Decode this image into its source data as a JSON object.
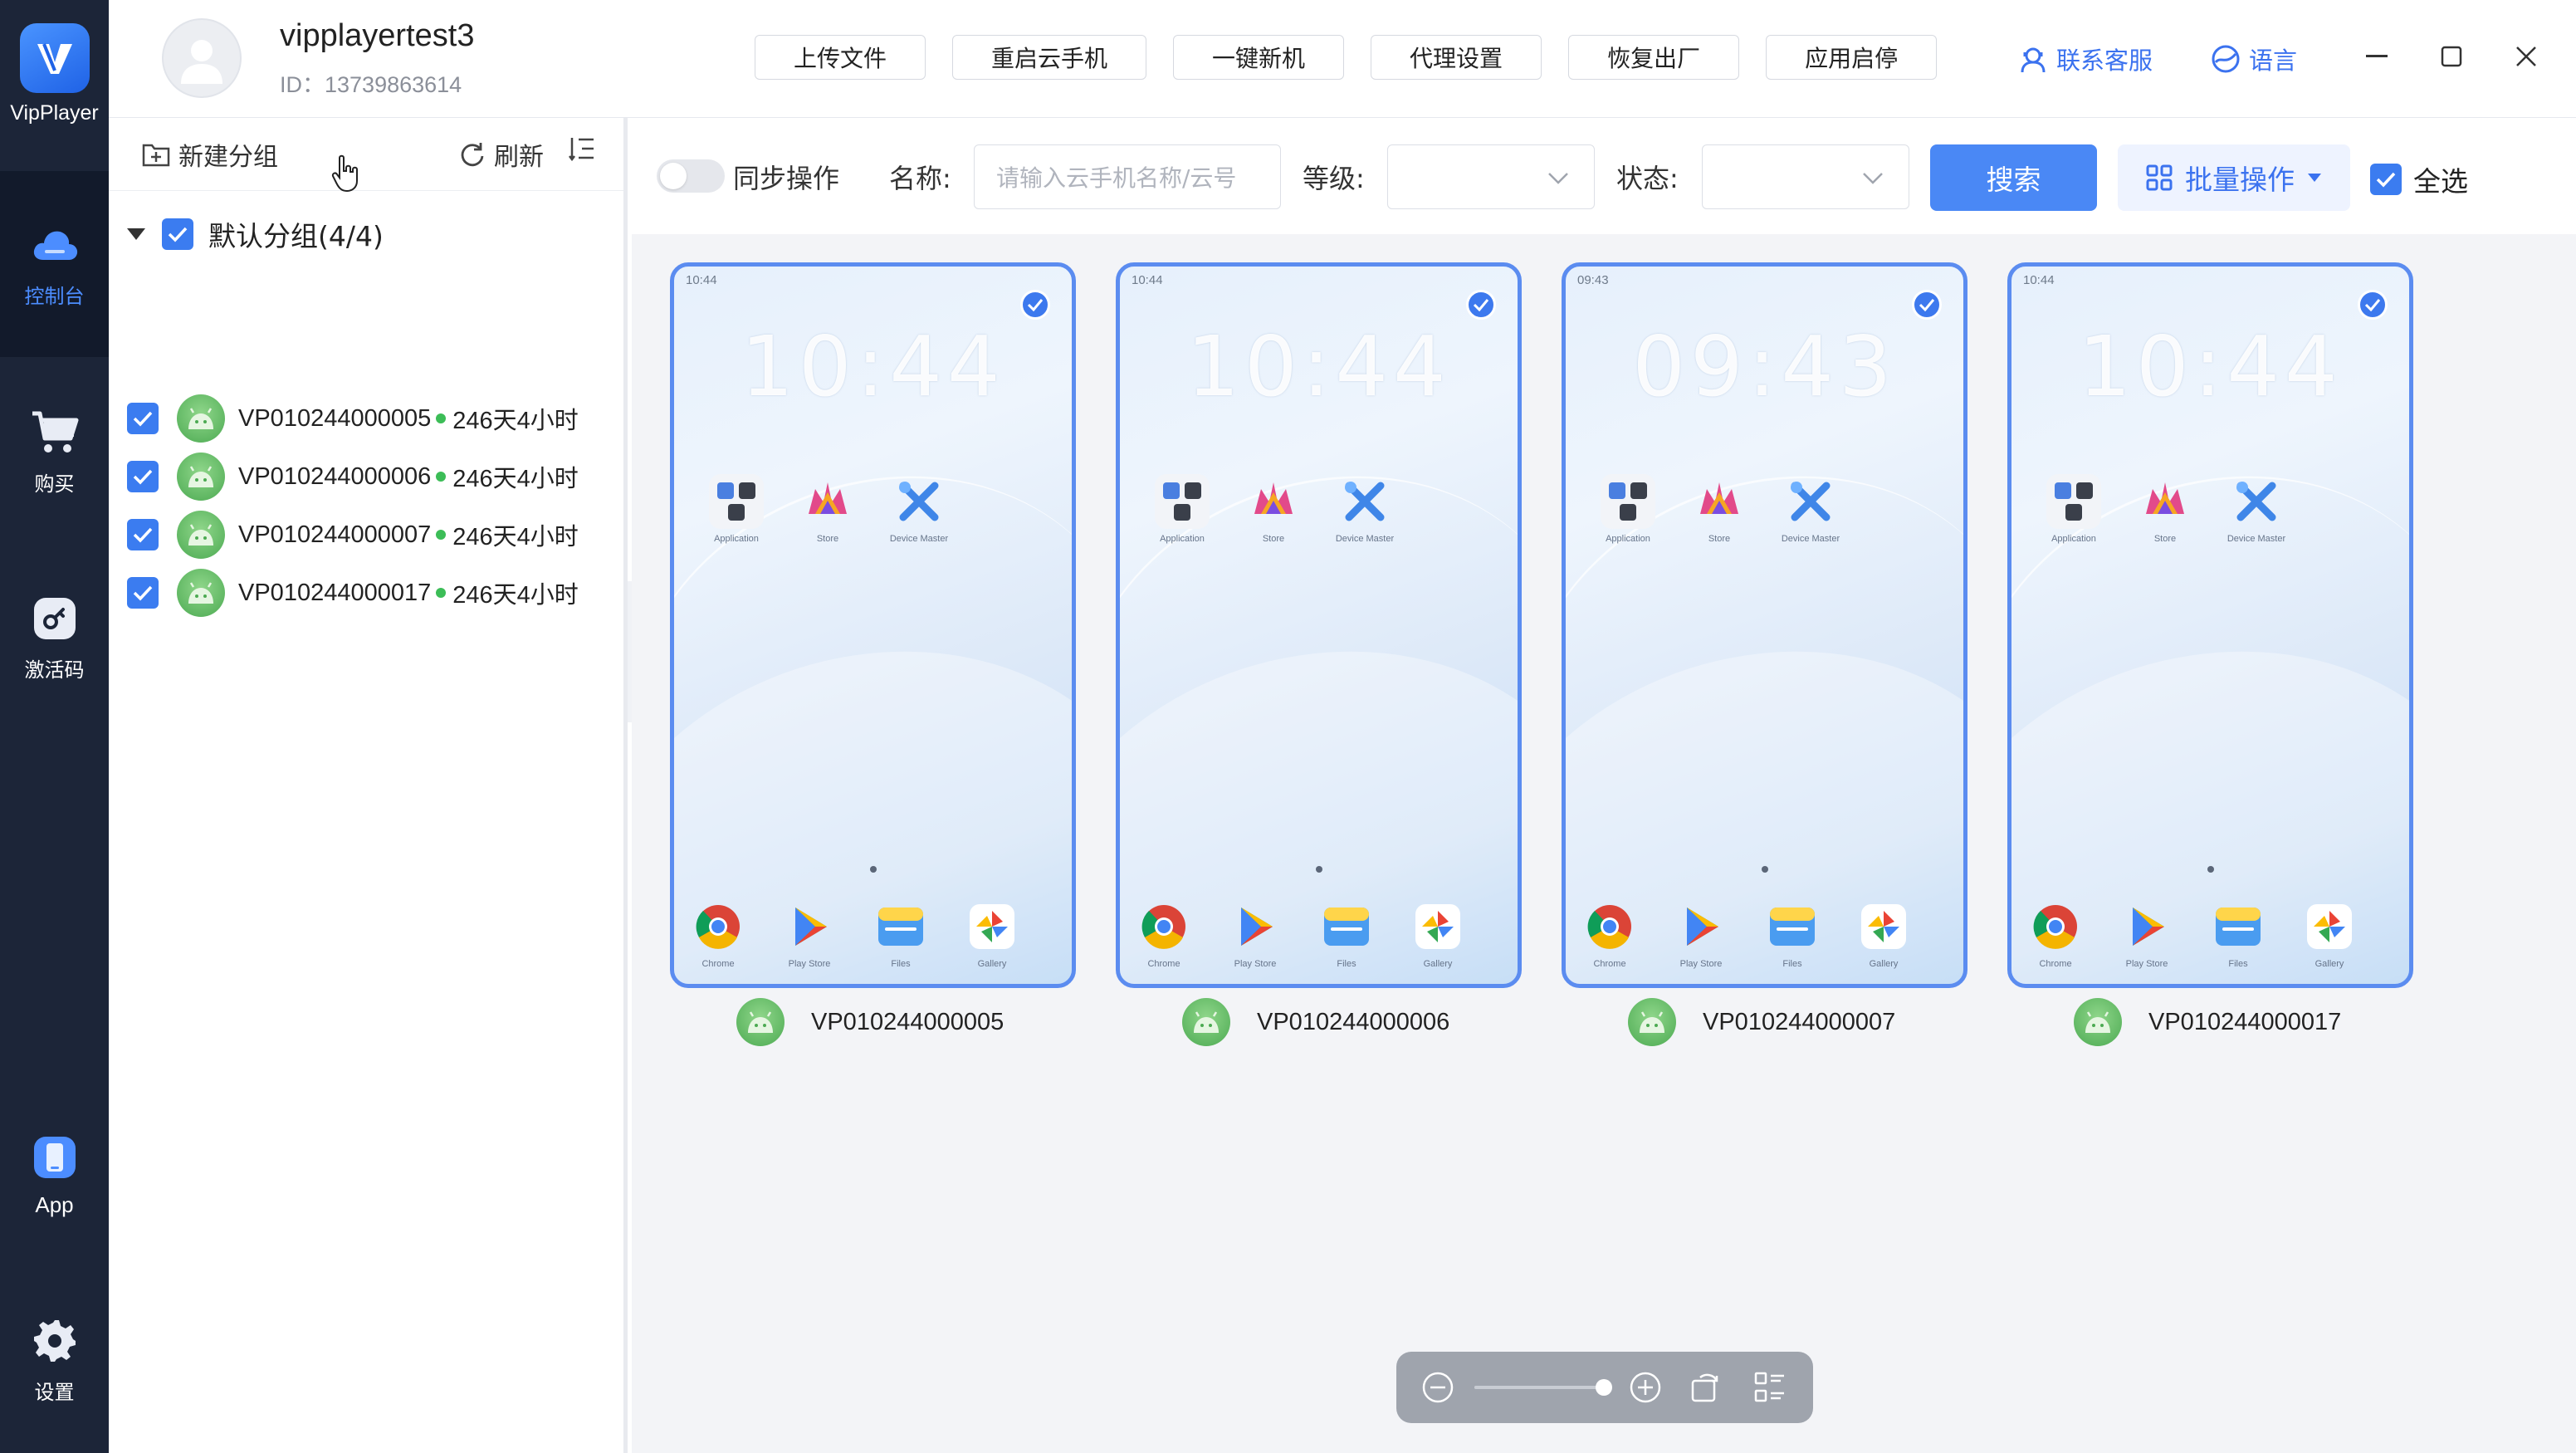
{
  "app": {
    "name": "VipPlayer"
  },
  "nav": [
    {
      "label": "控制台",
      "icon": "cloud-icon",
      "active": true
    },
    {
      "label": "购买",
      "icon": "cart-icon",
      "active": false
    },
    {
      "label": "激活码",
      "icon": "key-icon",
      "active": false
    },
    {
      "label": "App",
      "icon": "phone-icon",
      "active": false
    },
    {
      "label": "设置",
      "icon": "gear-icon",
      "active": false
    }
  ],
  "user": {
    "name": "vipplayertest3",
    "id": "ID：13739863614"
  },
  "top_actions": [
    "上传文件",
    "重启云手机",
    "一键新机",
    "代理设置",
    "恢复出厂",
    "应用启停"
  ],
  "top_links": {
    "support": "联系客服",
    "language": "语言"
  },
  "panel": {
    "new_group": "新建分组",
    "refresh": "刷新",
    "group_label": "默认分组(4/4)",
    "devices": [
      {
        "id": "VP010244000005",
        "duration": "246天4小时"
      },
      {
        "id": "VP010244000006",
        "duration": "246天4小时"
      },
      {
        "id": "VP010244000007",
        "duration": "246天4小时"
      },
      {
        "id": "VP010244000017",
        "duration": "246天4小时"
      }
    ]
  },
  "filters": {
    "sync_label": "同步操作",
    "name_label": "名称:",
    "name_placeholder": "请输入云手机名称/云号",
    "level_label": "等级:",
    "status_label": "状态:",
    "search_button": "搜索",
    "batch_button": "批量操作",
    "select_all": "全选"
  },
  "phones": [
    {
      "id": "VP010244000005",
      "status_time": "10:44",
      "clock": "10:44"
    },
    {
      "id": "VP010244000006",
      "status_time": "10:44",
      "clock": "10:44"
    },
    {
      "id": "VP010244000007",
      "status_time": "09:43",
      "clock": "09:43"
    },
    {
      "id": "VP010244000017",
      "status_time": "10:44",
      "clock": "10:44"
    }
  ],
  "phone_apps": {
    "top": [
      "Application",
      "Store",
      "Device Master"
    ],
    "dock": [
      "Chrome",
      "Play Store",
      "Files",
      "Gallery"
    ]
  },
  "zoom": {
    "level": 1.0
  },
  "colors": {
    "accent": "#4a88f5",
    "rail": "#1c2538",
    "card_border": "#5b8cf0",
    "online": "#3cbd57"
  }
}
